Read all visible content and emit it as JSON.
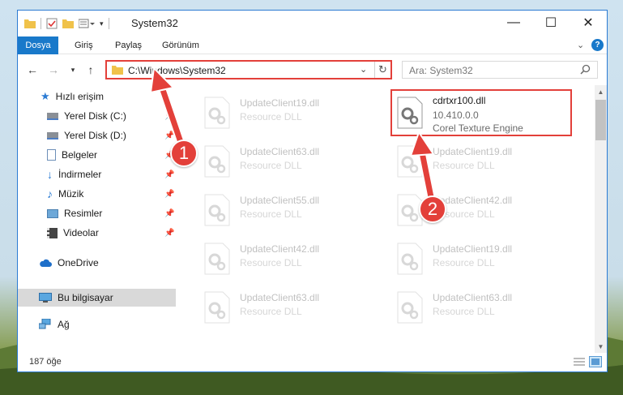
{
  "window": {
    "title": "System32",
    "controls": {
      "minimize": "—",
      "maximize": "☐",
      "close": "✕"
    }
  },
  "ribbon": {
    "tabs": [
      "Dosya",
      "Giriş",
      "Paylaş",
      "Görünüm"
    ],
    "expand_icon": "chevron-down-icon",
    "help_icon": "help-icon"
  },
  "nav": {
    "address": "C:\\Windows\\System32",
    "search_placeholder": "Ara: System32"
  },
  "sidebar": {
    "items": [
      {
        "label": "Hızlı erişim",
        "icon": "star-icon",
        "pinned": false
      },
      {
        "label": "Yerel Disk (C:)",
        "icon": "drive-icon",
        "pinned": true
      },
      {
        "label": "Yerel Disk (D:)",
        "icon": "drive-icon",
        "pinned": true
      },
      {
        "label": "Belgeler",
        "icon": "documents-icon",
        "pinned": true
      },
      {
        "label": "İndirmeler",
        "icon": "download-icon",
        "pinned": true
      },
      {
        "label": "Müzik",
        "icon": "music-icon",
        "pinned": true
      },
      {
        "label": "Resimler",
        "icon": "pictures-icon",
        "pinned": true
      },
      {
        "label": "Videolar",
        "icon": "video-icon",
        "pinned": true
      },
      {
        "label": "OneDrive",
        "icon": "cloud-icon",
        "pinned": false
      },
      {
        "label": "Bu bilgisayar",
        "icon": "computer-icon",
        "pinned": false,
        "selected": true
      },
      {
        "label": "Ağ",
        "icon": "network-icon",
        "pinned": false
      }
    ]
  },
  "files": [
    {
      "name": "UpdateClient19.dll",
      "type": "Resource DLL"
    },
    {
      "name": "cdrtxr100.dll",
      "version": "10.410.0.0",
      "description": "Corel Texture Engine",
      "highlighted": true
    },
    {
      "name": "UpdateClient63.dll",
      "type": "Resource DLL"
    },
    {
      "name": "UpdateClient19.dll",
      "type": "Resource DLL"
    },
    {
      "name": "UpdateClient55.dll",
      "type": "Resource DLL"
    },
    {
      "name": "UpdateClient42.dll",
      "type": "Resource DLL"
    },
    {
      "name": "UpdateClient42.dll",
      "type": "Resource DLL"
    },
    {
      "name": "UpdateClient19.dll",
      "type": "Resource DLL"
    },
    {
      "name": "UpdateClient63.dll",
      "type": "Resource DLL"
    },
    {
      "name": "UpdateClient63.dll",
      "type": "Resource DLL"
    }
  ],
  "status": {
    "item_count": "187 öğe"
  },
  "annotations": {
    "badge1": "1",
    "badge2": "2",
    "color": "#e3403a"
  }
}
